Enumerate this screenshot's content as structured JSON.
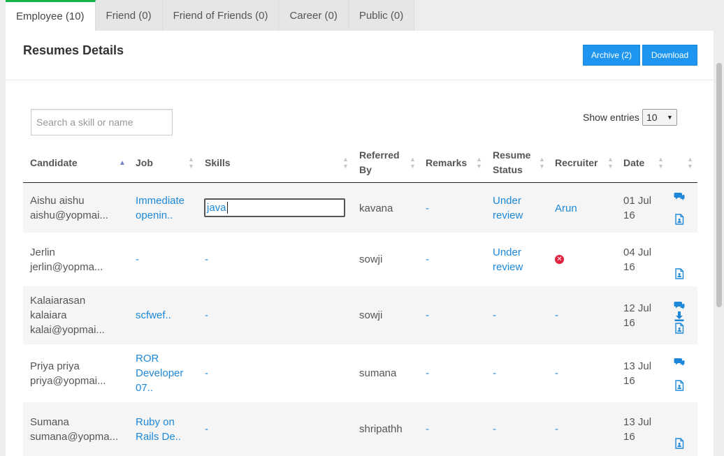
{
  "tabs": [
    {
      "label": "Employee (10)",
      "active": true
    },
    {
      "label": "Friend (0)",
      "active": false
    },
    {
      "label": "Friend of Friends (0)",
      "active": false
    },
    {
      "label": "Career (0)",
      "active": false
    },
    {
      "label": "Public (0)",
      "active": false
    }
  ],
  "header": {
    "title": "Resumes Details",
    "archive_label": "Archive (2)",
    "download_label": "Download"
  },
  "search": {
    "placeholder": "Search a skill or name",
    "value": ""
  },
  "entries": {
    "label": "Show entries",
    "value": "10"
  },
  "columns": {
    "candidate": "Candidate",
    "job": "Job",
    "skills": "Skills",
    "referred_by_1": "Referred",
    "referred_by_2": "By",
    "remarks": "Remarks",
    "status_1": "Resume",
    "status_2": "Status",
    "recruiter": "Recruiter",
    "date": "Date"
  },
  "rows": [
    {
      "name": "Aishu aishu",
      "email": "aishu@yopmai...",
      "job_1": "Immediate",
      "job_2": "openin..",
      "skills": "java",
      "referred_by": "kavana",
      "remarks": "-",
      "status_1": "Under",
      "status_2": "review",
      "recruiter": "Arun",
      "date_1": "01 Jul",
      "date_2": "16"
    },
    {
      "name": "Jerlin",
      "email": "jerlin@yopma...",
      "job": "-",
      "skills": "-",
      "referred_by": "sowji",
      "remarks": "-",
      "status_1": "Under",
      "status_2": "review",
      "recruiter": "",
      "date_1": "04 Jul",
      "date_2": "16"
    },
    {
      "name_1": "Kalaiarasan",
      "name_2": "kalaiara",
      "email": "kalai@yopmai...",
      "job": "scfwef..",
      "skills": "-",
      "referred_by": "sowji",
      "remarks": "-",
      "status": "-",
      "recruiter": "-",
      "date_1": "12 Jul",
      "date_2": "16"
    },
    {
      "name": "Priya priya",
      "email": "priya@yopmai...",
      "job_1": "ROR",
      "job_2": "Developer",
      "job_3": "07..",
      "skills": "-",
      "referred_by": "sumana",
      "remarks": "-",
      "status": "-",
      "recruiter": "-",
      "date_1": "13 Jul",
      "date_2": "16"
    },
    {
      "name": "Sumana",
      "email": "sumana@yopma...",
      "job_1": "Ruby on",
      "job_2": "Rails De..",
      "skills": "-",
      "referred_by": "shripathh",
      "remarks": "-",
      "status": "-",
      "recruiter": "-",
      "date_1": "13 Jul",
      "date_2": "16"
    }
  ],
  "icons": {
    "comment": "comment-icon",
    "resume": "resume-file-icon",
    "download": "download-icon",
    "remove": "remove-circle-icon"
  },
  "colors": {
    "accent": "#1e96f0",
    "link": "#1e88d8",
    "active_tab": "#16b545",
    "danger": "#e0213f"
  }
}
